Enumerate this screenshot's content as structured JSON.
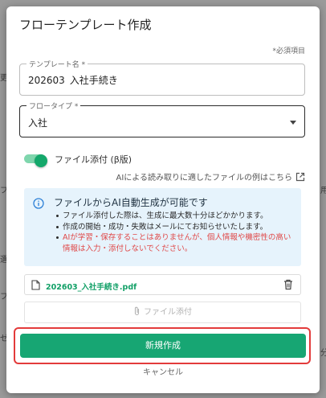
{
  "background_fragments": [
    "更",
    "フ",
    "用",
    "選",
    "フ",
    "ゼ",
    "分"
  ],
  "dialog": {
    "title": "フローテンプレート作成",
    "required_note": "*必須項目",
    "template_name": {
      "label": "テンプレート名 *",
      "value": "202603_入社手続き"
    },
    "flow_type": {
      "label": "フロータイプ *",
      "value": "入社"
    },
    "file_toggle": {
      "label": "ファイル添付 (β版)",
      "on": true
    },
    "example_link": "AIによる読み取りに適したファイルの例はこちら",
    "info": {
      "title": "ファイルからAI自動生成が可能です",
      "items": [
        "ファイル添付した際は、生成に最大数十分ほどかかります。",
        "作成の開始・成功・失敗はメールにてお知らせいたします。"
      ],
      "warning": "AIが学習・保存することはありませんが、個人情報や機密性の高い情報は入力・添付しないでください。"
    },
    "attached_file": {
      "name": "202603_入社手続き.pdf"
    },
    "attach_button": "ファイル添付",
    "primary_button": "新規作成",
    "cancel_button": "キャンセル"
  },
  "colors": {
    "accent": "#17a673",
    "warning": "#e04848",
    "info_bg": "#e6f3fc",
    "highlight": "#e33b3b"
  }
}
